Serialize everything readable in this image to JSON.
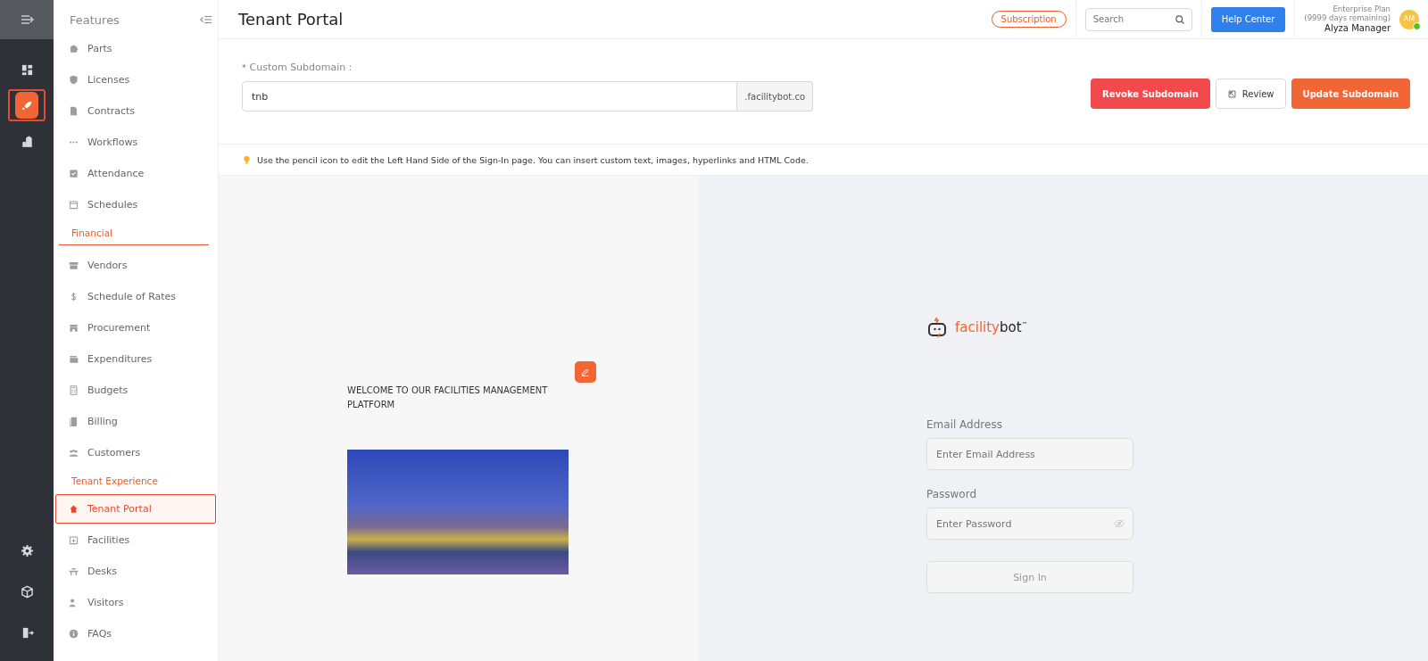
{
  "rail": {
    "top": [
      {
        "selected": false
      },
      {
        "selected": true
      },
      {
        "selected": false
      }
    ],
    "bottom": [
      {
        "selected": false
      },
      {
        "selected": false
      },
      {
        "selected": false
      }
    ]
  },
  "sidebar": {
    "title": "Features",
    "groups": [
      {
        "items": [
          {
            "label": "Parts",
            "selected": false
          },
          {
            "label": "Licenses",
            "selected": false
          },
          {
            "label": "Contracts",
            "selected": false
          },
          {
            "label": "Workflows",
            "selected": false
          },
          {
            "label": "Attendance",
            "selected": false
          },
          {
            "label": "Schedules",
            "selected": false
          }
        ]
      },
      {
        "label": "Financial",
        "underline": true,
        "items": [
          {
            "label": "Vendors",
            "selected": false
          },
          {
            "label": "Schedule of Rates",
            "selected": false
          },
          {
            "label": "Procurement",
            "selected": false
          },
          {
            "label": "Expenditures",
            "selected": false
          },
          {
            "label": "Budgets",
            "selected": false
          },
          {
            "label": "Billing",
            "selected": false
          },
          {
            "label": "Customers",
            "selected": false
          }
        ]
      },
      {
        "label": "Tenant Experience",
        "items": [
          {
            "label": "Tenant Portal",
            "selected": true
          },
          {
            "label": "Facilities",
            "selected": false
          },
          {
            "label": "Desks",
            "selected": false
          },
          {
            "label": "Visitors",
            "selected": false
          },
          {
            "label": "FAQs",
            "selected": false
          }
        ]
      }
    ]
  },
  "header": {
    "title": "Tenant Portal",
    "subscription": "Subscription",
    "search": {
      "placeholder": "Search"
    },
    "help": "Help Center",
    "plan": "Enterprise Plan",
    "days": "(9999 days remaining)",
    "user": "Alyza Manager",
    "initials": "AM",
    "online": true
  },
  "subdomain": {
    "required_mark": "*",
    "label": "Custom Subdomain：",
    "value": "tnb",
    "suffix": ".facilitybot.co",
    "buttons": [
      {
        "label": "Revoke Subdomain",
        "kind": "danger"
      },
      {
        "label": "Review",
        "kind": "plain"
      },
      {
        "label": "Update Subdomain",
        "kind": "primary"
      }
    ]
  },
  "tip": "Use the pencil icon to edit the Left Hand Side of the Sign-In page. You can insert custom text, images, hyperlinks and HTML Code.",
  "preview": {
    "welcome": "WELCOME TO OUR FACILITIES MANAGEMENT PLATFORM",
    "brand": {
      "first": "facility",
      "second": "bot",
      "mark": "™"
    },
    "email_label": "Email Address",
    "email_placeholder": "Enter Email Address",
    "password_label": "Password",
    "password_placeholder": "Enter Password",
    "sign_in": "Sign In"
  }
}
